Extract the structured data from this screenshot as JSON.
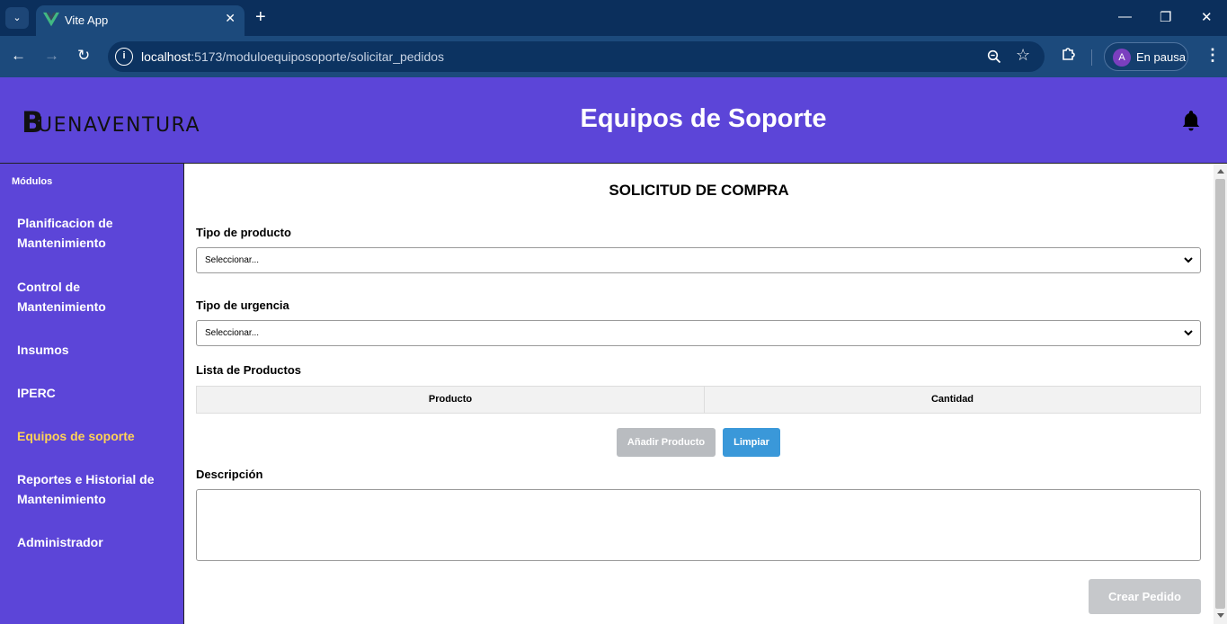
{
  "browser": {
    "tab_title": "Vite App",
    "url_host": "localhost",
    "url_rest": ":5173/moduloequiposoporte/solicitar_pedidos",
    "profile_initial": "A",
    "profile_label": "En pausa"
  },
  "header": {
    "logo_b": "B",
    "logo_rest": "UENAVENTURA",
    "title": "Equipos de Soporte"
  },
  "sidebar": {
    "title": "Módulos",
    "items": [
      {
        "label": "Planificacion de Mantenimiento"
      },
      {
        "label": "Control de Mantenimiento"
      },
      {
        "label": "Insumos"
      },
      {
        "label": "IPERC"
      },
      {
        "label": "Equipos de soporte",
        "active": true
      },
      {
        "label": "Reportes e Historial de Mantenimiento"
      },
      {
        "label": "Administrador"
      }
    ]
  },
  "form": {
    "title": "SOLICITUD DE COMPRA",
    "product_type_label": "Tipo de producto",
    "product_type_value": "Seleccionar...",
    "urgency_label": "Tipo de urgencia",
    "urgency_value": "Seleccionar...",
    "product_list_label": "Lista de Productos",
    "columns": [
      "Producto",
      "Cantidad"
    ],
    "add_button": "Añadir Producto",
    "clear_button": "Limpiar",
    "description_label": "Descripción",
    "description_value": "",
    "create_button": "Crear Pedido"
  },
  "colors": {
    "brand": "#5c45d8",
    "active_nav": "#ffd257",
    "clear_button": "#3a98d9",
    "disabled_button": "#b9bcc0"
  },
  "icons": [
    "vue-favicon-icon",
    "info-icon",
    "zoom-icon",
    "star-icon",
    "extensions-icon",
    "bell-icon",
    "chevron-down-icon"
  ]
}
